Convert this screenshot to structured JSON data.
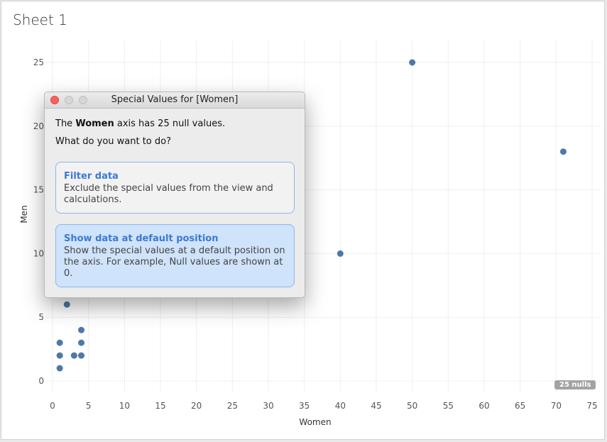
{
  "sheet": {
    "title": "Sheet 1"
  },
  "chart_data": {
    "type": "scatter",
    "xlabel": "Women",
    "ylabel": "Men",
    "xlim": [
      0,
      75
    ],
    "ylim": [
      0,
      25
    ],
    "x_ticks": [
      "0",
      "5",
      "10",
      "15",
      "20",
      "25",
      "30",
      "35",
      "40",
      "45",
      "50",
      "55",
      "60",
      "65",
      "70",
      "75"
    ],
    "y_ticks": [
      "0",
      "5",
      "10",
      "15",
      "20",
      "25"
    ],
    "grid": true,
    "point_color": "#4e79a7",
    "points": [
      {
        "x": 1,
        "y": 1
      },
      {
        "x": 1,
        "y": 2
      },
      {
        "x": 1,
        "y": 3
      },
      {
        "x": 2,
        "y": 6
      },
      {
        "x": 3,
        "y": 2
      },
      {
        "x": 4,
        "y": 2
      },
      {
        "x": 4,
        "y": 3
      },
      {
        "x": 4,
        "y": 4
      },
      {
        "x": 40,
        "y": 10
      },
      {
        "x": 50,
        "y": 25
      },
      {
        "x": 71,
        "y": 18
      }
    ]
  },
  "nulls_badge": "25 nulls",
  "dialog": {
    "title": "Special Values for [Women]",
    "msg_prefix": "The ",
    "msg_field": "Women",
    "msg_suffix": " axis has 25 null values.",
    "question": "What do you want to do?",
    "options": [
      {
        "title": "Filter data",
        "description": "Exclude the special values from the view and calculations."
      },
      {
        "title": "Show data at default position",
        "description": "Show the special values at a default position on the axis. For example, Null values are shown at 0."
      }
    ]
  }
}
